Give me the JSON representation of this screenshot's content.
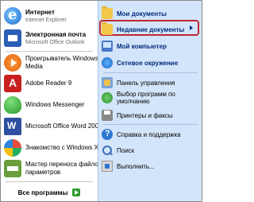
{
  "left": {
    "items": [
      {
        "label": "Интернет",
        "sub": "Internet Explorer",
        "icon": "internet-explorer-icon",
        "bold": true
      },
      {
        "label": "Электронная почта",
        "sub": "Microsoft Office Outlook",
        "icon": "outlook-icon",
        "bold": true
      },
      {
        "label": "Проигрыватель Windows",
        "sub": "Media",
        "icon": "windows-media-player-icon",
        "bold": false
      },
      {
        "label": "Adobe Reader 9",
        "sub": "",
        "icon": "adobe-reader-icon",
        "bold": false
      },
      {
        "label": "Windows Messenger",
        "sub": "",
        "icon": "windows-messenger-icon",
        "bold": false
      },
      {
        "label": "Microsoft Office Word 2007",
        "sub": "",
        "icon": "word-icon",
        "bold": false
      },
      {
        "label": "Знакомство с Windows XP",
        "sub": "",
        "icon": "windows-xp-tour-icon",
        "bold": false
      },
      {
        "label": "Мастер переноса файлов и",
        "sub": "параметров",
        "icon": "files-transfer-wizard-icon",
        "bold": false
      }
    ],
    "all_programs": "Все программы"
  },
  "right": {
    "items": [
      {
        "label": "Мои документы",
        "sub": "",
        "icon": "my-documents-icon",
        "bold": true
      },
      {
        "label": "Недавние документы",
        "sub": "",
        "icon": "recent-documents-icon",
        "bold": true,
        "highlighted": true
      },
      {
        "label": "Мой компьютер",
        "sub": "",
        "icon": "my-computer-icon",
        "bold": true
      },
      {
        "label": "Сетевое окружение",
        "sub": "",
        "icon": "network-places-icon",
        "bold": true
      },
      {
        "label": "Панель управления",
        "sub": "",
        "icon": "control-panel-icon",
        "bold": false
      },
      {
        "label": "Выбор программ по",
        "sub": "умолчанию",
        "icon": "default-programs-icon",
        "bold": false
      },
      {
        "label": "Принтеры и факсы",
        "sub": "",
        "icon": "printers-faxes-icon",
        "bold": false
      },
      {
        "label": "Справка и поддержка",
        "sub": "",
        "icon": "help-support-icon",
        "bold": false
      },
      {
        "label": "Поиск",
        "sub": "",
        "icon": "search-icon",
        "bold": false
      },
      {
        "label": "Выполнить...",
        "sub": "",
        "icon": "run-icon",
        "bold": false
      }
    ]
  },
  "colors": {
    "right_pane_bg": "#d3e5fa",
    "highlight_border": "#c0262d",
    "all_programs_arrow": "#2f9a2f"
  }
}
